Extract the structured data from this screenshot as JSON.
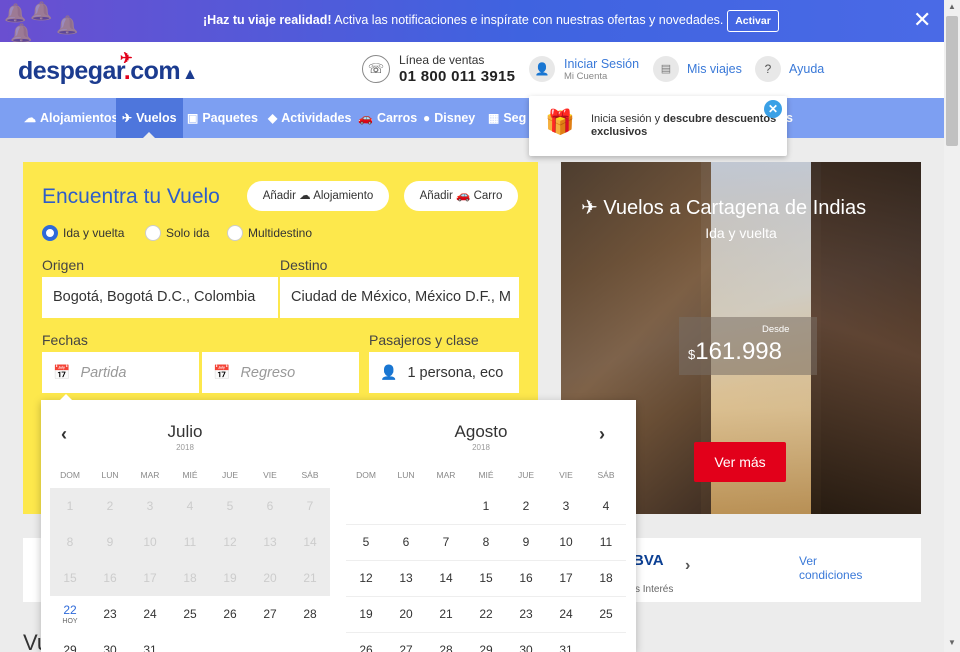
{
  "notification": {
    "bold_text": "¡Haz tu viaje realidad!",
    "text": " Activa las notificaciones e inspírate con nuestras ofertas y novedades.",
    "activate_label": "Activar",
    "close_symbol": "✕"
  },
  "header": {
    "logo_text": "despegar",
    "logo_com": "com",
    "sales_label": "Línea de ventas",
    "sales_phone": "01 800 011 3915",
    "login_label": "Iniciar Sesión",
    "login_sub": "Mi Cuenta",
    "trips_label": "Mis viajes",
    "help_label": "Ayuda"
  },
  "nav": {
    "items": [
      {
        "label": "Alojamientos",
        "icon": "bed-icon"
      },
      {
        "label": "Vuelos",
        "icon": "plane-icon"
      },
      {
        "label": "Paquetes",
        "icon": "suitcase-icon"
      },
      {
        "label": "Actividades",
        "icon": "ticket-icon"
      },
      {
        "label": "Carros",
        "icon": "car-icon"
      },
      {
        "label": "Disney",
        "icon": "mickey-icon"
      },
      {
        "label": "Seg",
        "icon": "insurance-icon"
      }
    ],
    "truncated_tail": "s"
  },
  "popover": {
    "text_prefix": "Inicia sesión y ",
    "text_bold": "descubre descuentos exclusivos"
  },
  "search": {
    "title": "Encuentra tu Vuelo",
    "add_hotel": "Añadir",
    "add_hotel_tail": "Alojamiento",
    "add_car": "Añadir",
    "add_car_tail": "Carro",
    "trip_types": [
      "Ida y vuelta",
      "Solo ida",
      "Multidestino"
    ],
    "origin_label": "Origen",
    "origin_value": "Bogotá, Bogotá D.C., Colombia",
    "destination_label": "Destino",
    "destination_value": "Ciudad de México, México D.F., M",
    "dates_label": "Fechas",
    "departure_placeholder": "Partida",
    "return_placeholder": "Regreso",
    "passengers_label": "Pasajeros y clase",
    "passengers_value": "1 persona, eco"
  },
  "calendar": {
    "weekdays": [
      "DOM",
      "LUN",
      "MAR",
      "MIÉ",
      "JUE",
      "VIE",
      "SÁB"
    ],
    "today_label": "HOY",
    "months": [
      {
        "name": "Julio",
        "year": "2018",
        "rows": [
          [
            "1",
            "2",
            "3",
            "4",
            "5",
            "6",
            "7"
          ],
          [
            "8",
            "9",
            "10",
            "11",
            "12",
            "13",
            "14"
          ],
          [
            "15",
            "16",
            "17",
            "18",
            "19",
            "20",
            "21"
          ],
          [
            "22",
            "23",
            "24",
            "25",
            "26",
            "27",
            "28"
          ],
          [
            "29",
            "30",
            "31",
            "",
            "",
            "",
            ""
          ]
        ],
        "past_until": 21,
        "today": 22
      },
      {
        "name": "Agosto",
        "year": "2018",
        "rows": [
          [
            "",
            "",
            "",
            "1",
            "2",
            "3",
            "4"
          ],
          [
            "5",
            "6",
            "7",
            "8",
            "9",
            "10",
            "11"
          ],
          [
            "12",
            "13",
            "14",
            "15",
            "16",
            "17",
            "18"
          ],
          [
            "19",
            "20",
            "21",
            "22",
            "23",
            "24",
            "25"
          ],
          [
            "26",
            "27",
            "28",
            "29",
            "30",
            "31",
            ""
          ]
        ]
      }
    ]
  },
  "promo": {
    "title": "Vuelos a Cartagena de Indias",
    "subtitle": "Ida y vuelta",
    "from_label": "Desde",
    "currency": "$",
    "price": "161.998",
    "button": "Ver más"
  },
  "bank": {
    "logo_fragment": "BVA",
    "interest_fragment": "s Interés",
    "conditions": "Ver condiciones"
  },
  "below_title_fragment": "Vu",
  "colors": {
    "brand_blue": "#1b3b8f",
    "nav_blue": "#7d9ff2",
    "search_yellow": "#fde84c",
    "accent_red": "#e2001a",
    "link_blue": "#3a79d8"
  }
}
